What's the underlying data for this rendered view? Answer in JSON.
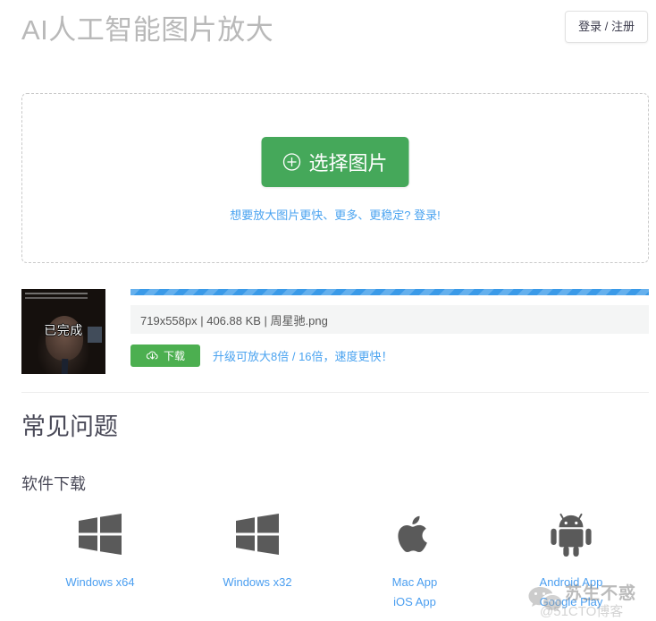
{
  "header": {
    "title": "AI人工智能图片放大",
    "login_label": "登录 / 注册"
  },
  "dropzone": {
    "select_button_label": "选择图片",
    "select_button_icon": "plus-circle-icon",
    "upsell_link": "想要放大图片更快、更多、更稳定? 登录!",
    "button_color": "#45a85a",
    "link_color": "#4aa3f0",
    "border_style": "dashed"
  },
  "file": {
    "status_label": "已完成",
    "progress_percent": 100,
    "progress_color": "#3a9ae8",
    "info": "719x558px | 406.88 KB | 周星驰.png",
    "dimensions": "719x558px",
    "size": "406.88 KB",
    "filename": "周星驰.png",
    "download_label": "下载",
    "download_icon": "cloud-download-icon",
    "download_color": "#4caf50",
    "upgrade_link": "升级可放大8倍 / 16倍，速度更快！"
  },
  "faq": {
    "title": "常见问题",
    "subtitle": "软件下载",
    "downloads": [
      {
        "icon": "windows-logo-icon",
        "labels": [
          "Windows x64"
        ]
      },
      {
        "icon": "windows-logo-icon",
        "labels": [
          "Windows x32"
        ]
      },
      {
        "icon": "apple-logo-icon",
        "labels": [
          "Mac App",
          "iOS App"
        ]
      },
      {
        "icon": "android-logo-icon",
        "labels": [
          "Android App",
          "Google Play"
        ]
      }
    ]
  },
  "watermark": {
    "text": "苏生不惑",
    "subtext": "@51CTO博客",
    "logo": "wechat-logo-icon"
  }
}
